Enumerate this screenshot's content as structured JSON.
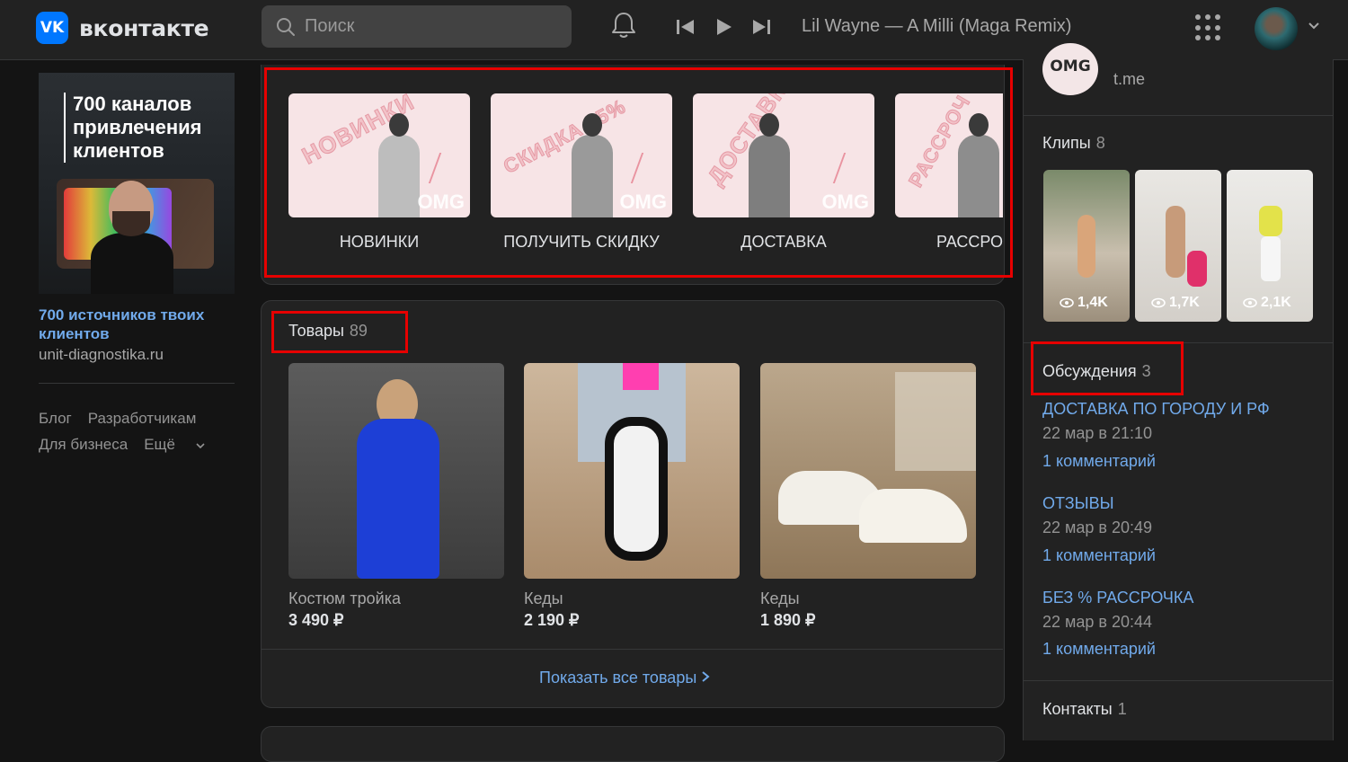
{
  "header": {
    "logo_mark": "VK",
    "logo_text": "вконтакте",
    "search_placeholder": "Поиск",
    "now_playing": "Lil Wayne — A Milli (Maga Remix)"
  },
  "left": {
    "ad": {
      "image_text": "700 каналов\nпривлечения\nклиентов",
      "title": "700 источников твоих клиентов",
      "domain": "unit-diagnostika.ru"
    },
    "footer_links": [
      "Блог",
      "Разработчикам",
      "Для бизнеса",
      "Ещё"
    ]
  },
  "stories": {
    "items": [
      {
        "image_text": "НОВИНКИ",
        "logo": "OMG",
        "label": "НОВИНКИ"
      },
      {
        "image_text": "СКИДКА 15%",
        "logo": "OMG",
        "label": "ПОЛУЧИТЬ СКИДКУ"
      },
      {
        "image_text": "ДОСТАВКА",
        "logo": "OMG",
        "label": "ДОСТАВКА"
      },
      {
        "image_text": "РАССРОЧ",
        "logo": "",
        "label": "РАССРО"
      }
    ]
  },
  "products": {
    "title": "Товары",
    "count": "89",
    "items": [
      {
        "name": "Костюм тройка",
        "price": "3 490 ₽"
      },
      {
        "name": "Кеды",
        "price": "2 190 ₽"
      },
      {
        "name": "Кеды",
        "price": "1 890 ₽"
      }
    ],
    "show_all": "Показать все товары"
  },
  "right": {
    "link": {
      "avatar_text": "OMG",
      "domain": "t.me"
    },
    "clips": {
      "title": "Клипы",
      "count": "8",
      "items": [
        {
          "views": "1,4K"
        },
        {
          "views": "1,7K"
        },
        {
          "views": "2,1K"
        }
      ]
    },
    "discussions": {
      "title": "Обсуждения",
      "count": "3",
      "items": [
        {
          "title": "ДОСТАВКА ПО ГОРОДУ И РФ",
          "date": "22 мар в 21:10",
          "comments": "1 комментарий"
        },
        {
          "title": "ОТЗЫВЫ",
          "date": "22 мар в 20:49",
          "comments": "1 комментарий"
        },
        {
          "title": "БЕЗ % РАССРОЧКА",
          "date": "22 мар в 20:44",
          "comments": "1 комментарий"
        }
      ]
    },
    "contacts": {
      "title": "Контакты",
      "count": "1"
    }
  },
  "colors": {
    "accent": "#0077ff",
    "link": "#71aaeb",
    "highlight": "#e60000",
    "background": "#141414",
    "card": "#222222"
  }
}
